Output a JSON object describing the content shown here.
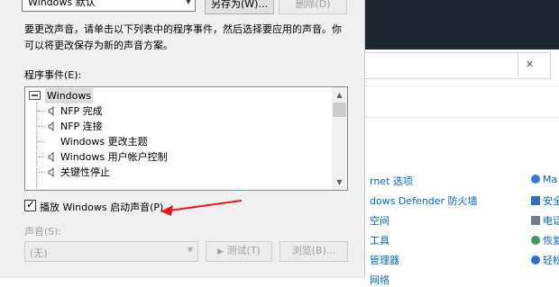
{
  "dialog": {
    "scheme_value": "Windows 默认",
    "save_as_label": "另存为(W)...",
    "delete_label": "删除(D)",
    "description": "要更改声音，请单击以下列表中的程序事件，然后选择要应用的声音。你可以将更改保存为新的声音方案。",
    "events_label": "程序事件(E):",
    "events": [
      {
        "label": "Windows",
        "root": true,
        "icon": "windows-icon"
      },
      {
        "label": "NFP 完成",
        "icon": "speaker-icon"
      },
      {
        "label": "NFP 连接",
        "icon": "speaker-icon"
      },
      {
        "label": "Windows 更改主题",
        "icon": ""
      },
      {
        "label": "Windows 用户帐户控制",
        "icon": "speaker-icon"
      },
      {
        "label": "关键性停止",
        "icon": "speaker-icon"
      }
    ],
    "play_startup_label": "播放 Windows 启动声音(P)",
    "play_startup_checked": true,
    "sound_label": "声音(S):",
    "sound_value": "(无)",
    "test_label": "测试(T)",
    "browse_label": "浏览(B)..."
  },
  "background": {
    "items_col1": [
      "rnet 选项",
      "dows Defender 防火墙",
      "空间",
      "工具",
      "管理器",
      "网络"
    ],
    "items_col2": [
      "Ma",
      "安全",
      "电话",
      "恢复",
      "轻松",
      ""
    ]
  },
  "colors": {
    "annotation_arrow": "#e8161b",
    "link": "#0066cc"
  }
}
